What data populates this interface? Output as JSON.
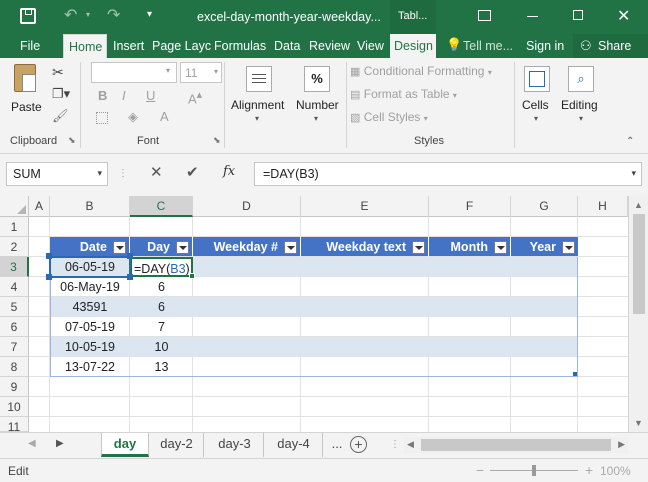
{
  "title": {
    "filename": "excel-day-month-year-weekday...",
    "context_tab": "Tabl...",
    "save_icon": "save-icon",
    "undo_icon": "undo-icon",
    "redo_icon": "redo-icon"
  },
  "ribbon_tabs": [
    "File",
    "Home",
    "Insert",
    "Page Layc",
    "Formulas",
    "Data",
    "Review",
    "View",
    "Design"
  ],
  "tell_me": "Tell me...",
  "sign_in": "Sign in",
  "share": "Share",
  "ribbon": {
    "paste": "Paste",
    "clipboard": "Clipboard",
    "font_size": "11",
    "font": "Font",
    "alignment": "Alignment",
    "number": "Number",
    "percent": "%",
    "conditional_formatting": "Conditional Formatting",
    "format_as_table": "Format as Table",
    "cell_styles": "Cell Styles",
    "styles": "Styles",
    "cells": "Cells",
    "editing": "Editing",
    "bold": "B",
    "italic": "I",
    "underline": "U"
  },
  "formula_bar": {
    "name_box": "SUM",
    "fx": "fx",
    "formula": "=DAY(B3)"
  },
  "columns": [
    "A",
    "B",
    "C",
    "D",
    "E",
    "F",
    "G",
    "H"
  ],
  "rows": [
    "1",
    "2",
    "3",
    "4",
    "5",
    "6",
    "7",
    "8",
    "9",
    "10",
    "11"
  ],
  "table_headers": [
    "Date",
    "Day",
    "Weekday #",
    "Weekday text",
    "Month",
    "Year"
  ],
  "table_rows": [
    {
      "date": "06-05-19",
      "day_prefix": "=DAY(",
      "day_ref": "B3",
      "day_suffix": ")"
    },
    {
      "date": "06-May-19",
      "day": "6"
    },
    {
      "date": "43591",
      "day": "6"
    },
    {
      "date": "07-05-19",
      "day": "7"
    },
    {
      "date": "10-05-19",
      "day": "10"
    },
    {
      "date": "13-07-22",
      "day": "13"
    }
  ],
  "sheets": [
    "day",
    "day-2",
    "day-3",
    "day-4"
  ],
  "more_sheets": "...",
  "status": {
    "mode": "Edit",
    "zoom": "100%",
    "zoom_minus": "−",
    "zoom_plus": "+"
  }
}
